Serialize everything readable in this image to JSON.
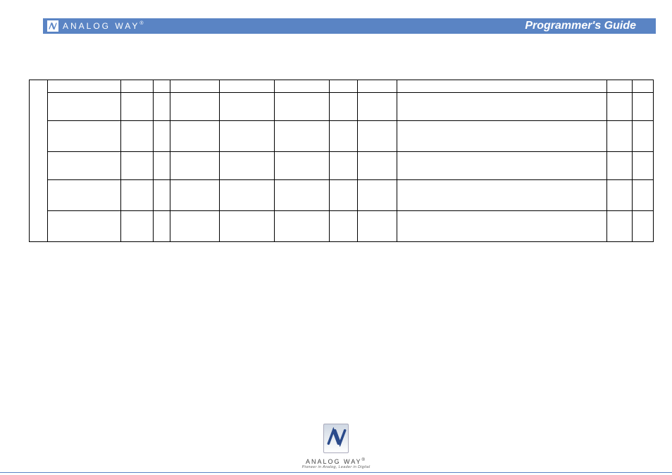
{
  "header": {
    "brand": "ANALOG WAY",
    "brand_mark": "®",
    "title": "Programmer's Guide"
  },
  "footer": {
    "brand": "ANALOG WAY",
    "brand_mark": "®",
    "tagline": "Pioneer in Analog, Leader in Digital"
  },
  "table": {
    "group_label": "",
    "rows": [
      {
        "height": 1,
        "cond": "",
        "name": "",
        "cmd": "",
        "rw": "",
        "type": "",
        "idx1": "",
        "idx2": "",
        "min": "",
        "max": "",
        "desc": "",
        "note1": "",
        "note2": ""
      },
      {
        "height": 2,
        "cond": "",
        "name": "",
        "cmd": "",
        "rw": "",
        "type": "",
        "idx1": "",
        "idx2": "",
        "min": "",
        "max": "",
        "desc": "",
        "note1": "",
        "note2": ""
      },
      {
        "height": 3,
        "cond": "",
        "name": "",
        "cmd": "",
        "rw": "",
        "type": "",
        "idx1": "",
        "idx2": "",
        "min": "",
        "max": "",
        "desc": "",
        "note1": "",
        "note2": ""
      },
      {
        "height": 2,
        "cond": "",
        "name": "",
        "cmd": "",
        "rw": "",
        "type": "",
        "idx1": "",
        "idx2": "",
        "min": "",
        "max": "",
        "desc": "",
        "note1": "",
        "note2": ""
      },
      {
        "height": 3,
        "cond": "",
        "name": "",
        "cmd": "",
        "rw": "",
        "type": "",
        "idx1": "",
        "idx2": "",
        "min": "",
        "max": "",
        "desc": "",
        "note1": "",
        "note2": ""
      },
      {
        "height": 3,
        "cond": "",
        "name": "",
        "cmd": "",
        "rw": "",
        "type": "",
        "idx1": "",
        "idx2": "",
        "min": "",
        "max": "",
        "desc": "",
        "note1": "",
        "note2": ""
      }
    ]
  }
}
